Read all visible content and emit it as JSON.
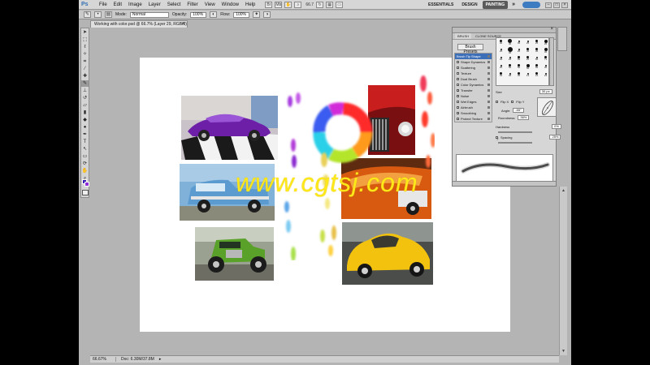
{
  "menubar": {
    "logo": "Ps",
    "items": [
      "File",
      "Edit",
      "Image",
      "Layer",
      "Select",
      "Filter",
      "View",
      "Window",
      "Help"
    ],
    "zoom": "66.7",
    "workspaces": [
      "ESSENTIALS",
      "DESIGN",
      "PAINTING"
    ],
    "more": "»",
    "win_controls": [
      "–",
      "□",
      "×"
    ]
  },
  "options": {
    "mode_label": "Mode:",
    "mode_value": "Normal",
    "opacity_label": "Opacity:",
    "opacity_value": "100%",
    "flow_label": "Flow:",
    "flow_value": "100%"
  },
  "document": {
    "tab_title": "Working with color.psd @ 66.7% (Layer 29, RGB/8)",
    "close": "×"
  },
  "status": {
    "zoom": "66.67%",
    "doc": "Doc: 6.30M/37.8M",
    "arrow": "▸"
  },
  "brush_panel": {
    "header_close": "×",
    "tabs": [
      "BRUSH",
      "CLONE SOURCE"
    ],
    "presets_button": "Brush Presets",
    "options": [
      {
        "label": "Brush Tip Shape",
        "checked": null,
        "selected": true
      },
      {
        "label": "Shape Dynamics",
        "checked": false
      },
      {
        "label": "Scattering",
        "checked": false
      },
      {
        "label": "Texture",
        "checked": false
      },
      {
        "label": "Dual Brush",
        "checked": false
      },
      {
        "label": "Color Dynamics",
        "checked": false
      },
      {
        "label": "Transfer",
        "checked": true
      },
      {
        "label": "Noise",
        "checked": false
      },
      {
        "label": "Wet Edges",
        "checked": false
      },
      {
        "label": "Airbrush",
        "checked": false
      },
      {
        "label": "Smoothing",
        "checked": true
      },
      {
        "label": "Protect Texture",
        "checked": false
      }
    ],
    "grid": [
      {
        "n": "30",
        "s": 3
      },
      {
        "n": "30",
        "s": 5
      },
      {
        "n": "30",
        "s": 2
      },
      {
        "n": "25",
        "s": 2
      },
      {
        "n": "25",
        "s": 3
      },
      {
        "n": "25",
        "s": 4
      },
      {
        "n": "25",
        "s": 2
      },
      {
        "n": "36",
        "s": 6
      },
      {
        "n": "25",
        "s": 2
      },
      {
        "n": "36",
        "s": 3
      },
      {
        "n": "36",
        "s": 3
      },
      {
        "n": "36",
        "s": 4
      },
      {
        "n": "32",
        "s": 2
      },
      {
        "n": "25",
        "s": 2
      },
      {
        "n": "50",
        "s": 3
      },
      {
        "n": "25",
        "s": 3
      },
      {
        "n": "50",
        "s": 2
      },
      {
        "n": "71",
        "s": 3
      },
      {
        "n": "25",
        "s": 2
      },
      {
        "n": "50",
        "s": 3
      },
      {
        "n": "50",
        "s": 3
      },
      {
        "n": "50",
        "s": 4
      },
      {
        "n": "50",
        "s": 3
      },
      {
        "n": "36",
        "s": 2
      },
      {
        "n": "32",
        "s": 3
      },
      {
        "n": "36",
        "s": 2
      },
      {
        "n": "30",
        "s": 3
      },
      {
        "n": "14",
        "s": 2
      },
      {
        "n": "21",
        "s": 3
      },
      {
        "n": "23",
        "s": 2
      }
    ],
    "size_label": "Size",
    "size_value": "30 px",
    "flip_x": "Flip X",
    "flip_y": "Flip Y",
    "angle_label": "Angle:",
    "angle_value": "-55°",
    "roundness_label": "Roundness:",
    "roundness_value": "36%",
    "hardness_label": "Hardness",
    "hardness_value": "0%",
    "spacing_label": "Spacing",
    "spacing_value": "25%"
  },
  "watermark": "www.cgtsj.com",
  "colors": {
    "foreground": "#3a1db0",
    "background": "#8f2fd8"
  }
}
